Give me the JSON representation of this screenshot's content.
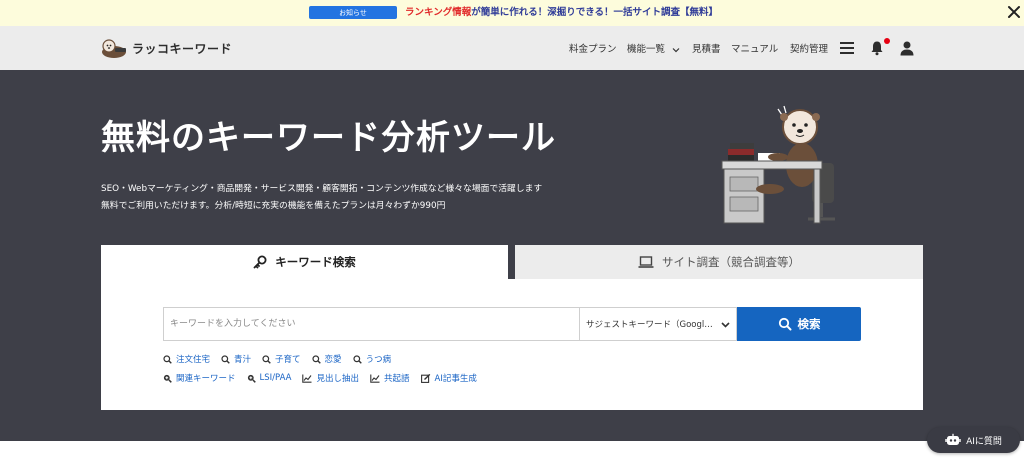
{
  "announcement": {
    "badge": "お知らせ",
    "highlight": "ランキング情報",
    "message": "が簡単に作れる！深掘りできる！一括サイト調査【無料】"
  },
  "header": {
    "logo_text": "ラッコキーワード",
    "nav": [
      "料金プラン",
      "機能一覧",
      "見積書",
      "マニュアル",
      "契約管理"
    ]
  },
  "hero": {
    "title": "無料のキーワード分析ツール",
    "desc_line1": "SEO・Webマーケティング・商品開発・サービス開発・顧客開拓・コンテンツ作成など様々な場面で活躍します",
    "desc_line2": "無料でご利用いただけます。分析/時短に充実の機能を備えたプランは月々わずか990円"
  },
  "tabs": {
    "keyword": "キーワード検索",
    "site": "サイト調査（競合調査等）"
  },
  "search": {
    "placeholder": "キーワードを入力してください",
    "mode": "サジェストキーワード（Google）",
    "button": "検索"
  },
  "suggested": [
    "注文住宅",
    "青汁",
    "子育て",
    "恋愛",
    "うつ病"
  ],
  "tools": [
    "関連キーワード",
    "LSI/PAA",
    "見出し抽出",
    "共起語",
    "AI記事生成"
  ],
  "ai_chat": "AIに質問",
  "colors": {
    "primary": "#1565c0",
    "hero_bg": "#3e3f48",
    "alert": "#e60012"
  }
}
